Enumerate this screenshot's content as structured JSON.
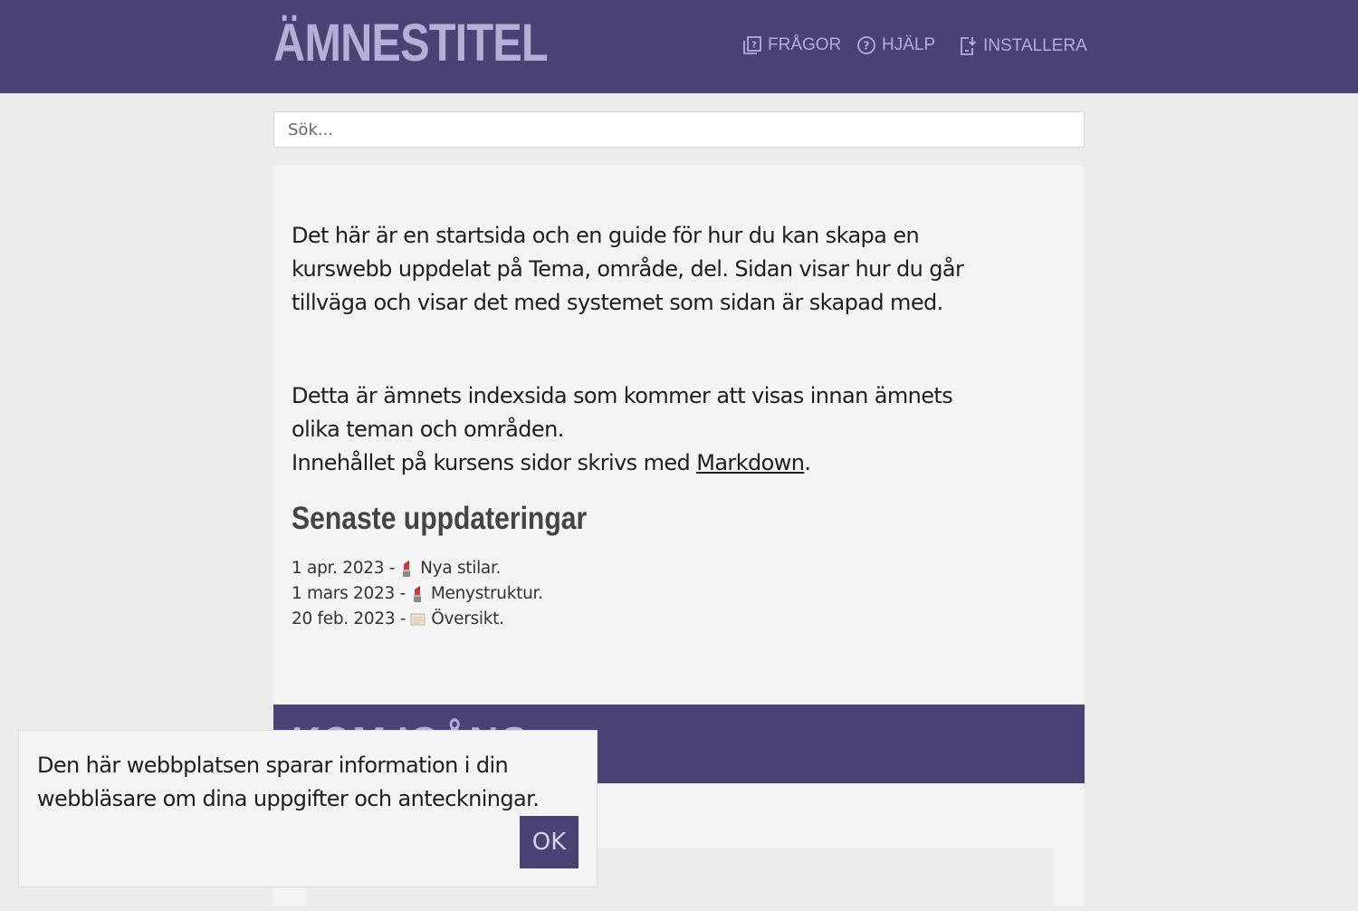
{
  "header": {
    "title": "ÄMNESTITEL",
    "nav": [
      {
        "label": "FRÅGOR",
        "icon": "questions-icon"
      },
      {
        "label": "HJÄLP",
        "icon": "help-circle-icon"
      },
      {
        "label": "INSTALLERA",
        "icon": "install-icon"
      }
    ]
  },
  "search": {
    "placeholder": "Sök..."
  },
  "main": {
    "intro": "Det här är en startsida och en guide för hur du kan skapa en kurswebb uppdelat på Tema, område, del. Sidan visar hur du går tillväga och visar det med systemet som sidan är skapad med.",
    "index_line": "Detta är ämnets indexsida som kommer att visas innan ämnets olika teman och områden.",
    "content_line_prefix": "Innehållet på kursens sidor skrivs med ",
    "markdown_link": "Markdown",
    "content_line_suffix": ".",
    "updates_heading": "Senaste uppdateringar",
    "updates": [
      {
        "date": "1 apr. 2023 -",
        "icon": "lipstick-icon",
        "text": "Nya stilar."
      },
      {
        "date": "1 mars 2023 -",
        "icon": "lipstick-icon",
        "text": "Menystruktur."
      },
      {
        "date": "20 feb. 2023 -",
        "icon": "scroll-icon",
        "text": "Översikt."
      }
    ]
  },
  "section": {
    "title": "KOM IGÅNG"
  },
  "cookie_notice": {
    "text": "Den här webbplatsen sparar information i din webbläsare om dina uppgifter och anteckningar.",
    "ok_label": "OK"
  },
  "colors": {
    "header_bg": "#4b4174",
    "header_text": "#b6aed6",
    "page_bg": "#ececec",
    "panel_bg": "#f4f4f4"
  }
}
